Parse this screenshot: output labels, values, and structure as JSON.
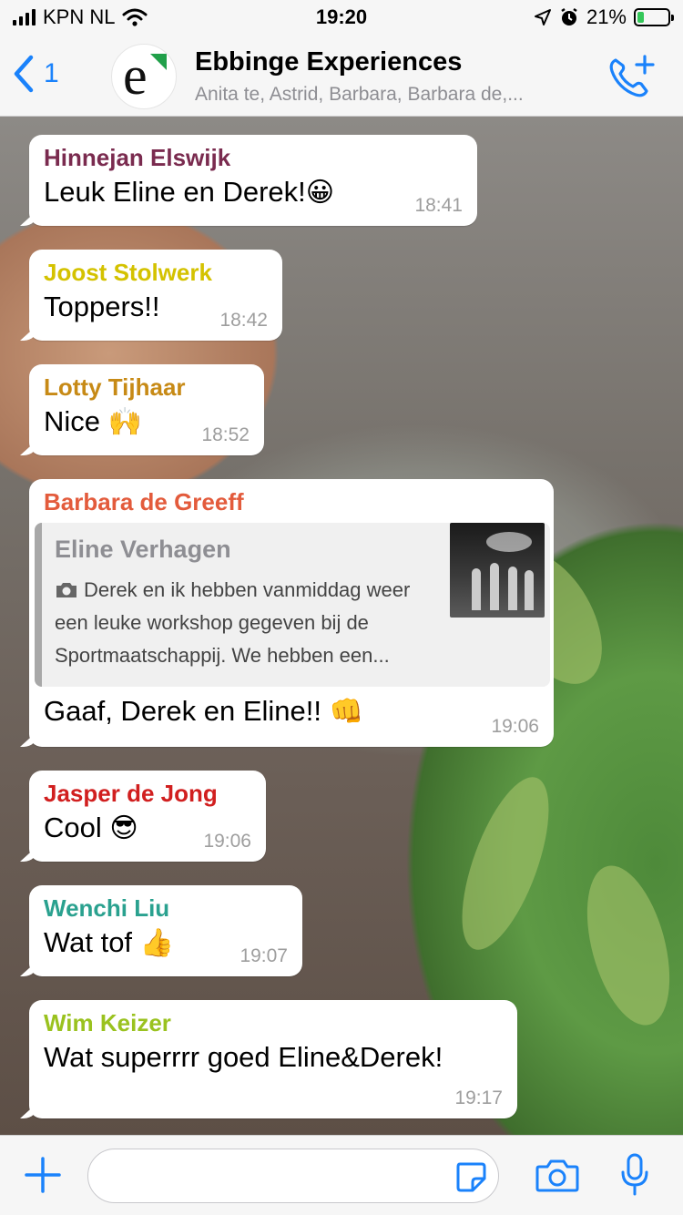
{
  "status_bar": {
    "carrier": "KPN NL",
    "time": "19:20",
    "battery": "21%",
    "battery_level": 0.21
  },
  "header": {
    "back_count": "1",
    "avatar_letter": "e",
    "title": "Ebbinge Experiences",
    "subtitle": "Anita te, Astrid, Barbara, Barbara de,..."
  },
  "messages": [
    {
      "sender": "Hinnejan Elswijk",
      "sender_color": "#7a2b4f",
      "text": "Leuk Eline en Derek!",
      "emoji": "😀",
      "time": "18:41"
    },
    {
      "sender": "Joost Stolwerk",
      "sender_color": "#d4c200",
      "text": "Toppers!!",
      "emoji": "",
      "time": "18:42"
    },
    {
      "sender": "Lotty Tijhaar",
      "sender_color": "#c78a16",
      "text": "Nice",
      "emoji": "🙌",
      "time": "18:52"
    },
    {
      "sender": "Barbara de Greeff",
      "sender_color": "#e35b3c",
      "text": "Gaaf, Derek en Eline!!",
      "emoji": "👊",
      "time": "19:06",
      "quote": {
        "sender": "Eline Verhagen",
        "text": "Derek en ik hebben vanmiddag weer een leuke workshop gegeven bij de Sportmaatschappij. We hebben een..."
      }
    },
    {
      "sender": "Jasper de Jong",
      "sender_color": "#d11f1f",
      "text": "Cool",
      "emoji": "😎",
      "time": "19:06"
    },
    {
      "sender": "Wenchi Liu",
      "sender_color": "#2aa18f",
      "text": "Wat tof",
      "emoji": "👍",
      "time": "19:07"
    },
    {
      "sender": "Wim Keizer",
      "sender_color": "#9ac21f",
      "text": "Wat superrrr goed Eline&Derek!",
      "emoji": "",
      "time": "19:17"
    }
  ],
  "composer": {
    "value": "",
    "placeholder": ""
  },
  "colors": {
    "accent": "#1a82fb",
    "bar_bg": "#f6f6f6"
  },
  "icons": [
    "back-chevron-icon",
    "add-call-icon",
    "plus-icon",
    "sticker-icon",
    "camera-icon",
    "microphone-icon",
    "location-arrow-icon",
    "alarm-icon",
    "wifi-icon",
    "signal-icon",
    "battery-icon"
  ]
}
